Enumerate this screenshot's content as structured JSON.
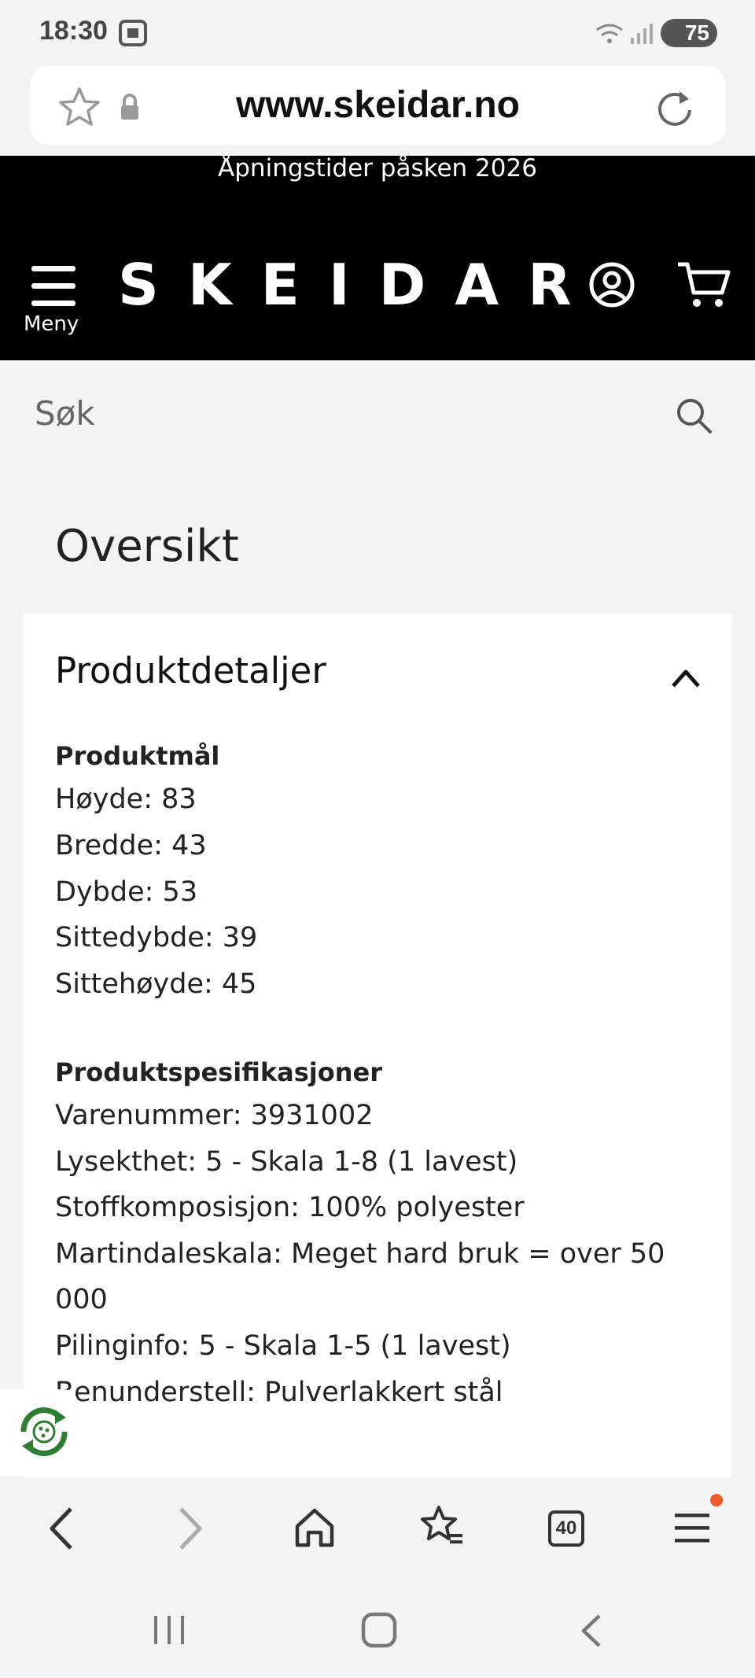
{
  "status_bar": {
    "time": "18:30",
    "battery": "75"
  },
  "browser": {
    "url": "www.skeidar.no",
    "tab_count": "40"
  },
  "header": {
    "promo": "Åpningstider påsken 2026",
    "logo": "SKEIDAR",
    "menu_label": "Meny"
  },
  "search": {
    "placeholder": "Søk"
  },
  "overview": {
    "title": "Oversikt"
  },
  "details": {
    "title": "Produktdetaljer",
    "dimensions_heading": "Produktmål",
    "dimensions": [
      "Høyde: 83",
      "Bredde: 43",
      "Dybde: 53",
      "Sittedybde: 39",
      "Sittehøyde: 45"
    ],
    "specs_heading": "Produktspesifikasjoner",
    "specs": [
      "Varenummer: 3931002",
      "Lysekthet: 5 - Skala 1-8 (1 lavest)",
      "Stoffkomposisjon: 100% polyester",
      "Martindaleskala: Meget hard bruk = over 50",
      "000",
      "Pilinginfo: 5 - Skala 1-5 (1 lavest)",
      "Benunderstell: Pulverlakkert stål"
    ]
  },
  "colors": {
    "header_bg": "#000000",
    "notification_dot": "#f05a28",
    "badge_green": "#2e7d32"
  }
}
